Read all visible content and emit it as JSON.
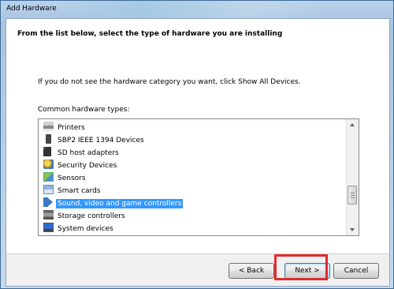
{
  "window": {
    "title": "Add Hardware",
    "header": "From the list below, select the type of hardware you are installing"
  },
  "content": {
    "instruction": "If you do not see the hardware category you want, click Show All Devices.",
    "list_label": "Common hardware types:",
    "list_items": [
      {
        "label": "Printers",
        "icon": "printer-icon",
        "selected": false
      },
      {
        "label": "SBP2 IEEE 1394 Devices",
        "icon": "ieee1394-icon",
        "selected": false
      },
      {
        "label": "SD host adapters",
        "icon": "sd-card-icon",
        "selected": false
      },
      {
        "label": "Security Devices",
        "icon": "security-icon",
        "selected": false
      },
      {
        "label": "Sensors",
        "icon": "sensor-icon",
        "selected": false
      },
      {
        "label": "Smart cards",
        "icon": "smart-card-icon",
        "selected": false
      },
      {
        "label": "Sound, video and game controllers",
        "icon": "speaker-icon",
        "selected": true
      },
      {
        "label": "Storage controllers",
        "icon": "storage-controller-icon",
        "selected": false
      },
      {
        "label": "System devices",
        "icon": "system-devices-icon",
        "selected": false
      }
    ]
  },
  "buttons": {
    "back": "< Back",
    "next": "Next >",
    "cancel": "Cancel"
  },
  "colors": {
    "selection": "#3399ff",
    "highlight_box": "#e22b2b"
  }
}
